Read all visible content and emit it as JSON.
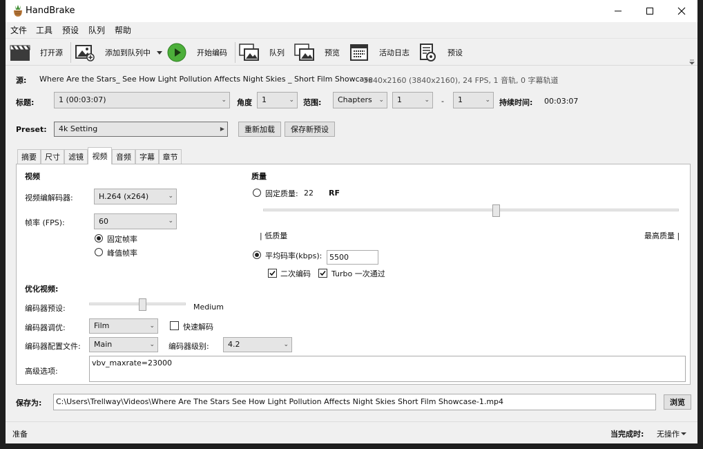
{
  "window": {
    "title": "HandBrake"
  },
  "menu": [
    "文件",
    "工具",
    "预设",
    "队列",
    "帮助"
  ],
  "toolbar": {
    "open_source": "打开源",
    "add_to_queue": "添加到队列中",
    "start_encode": "开始编码",
    "queue": "队列",
    "preview": "预览",
    "activity_log": "活动日志",
    "presets": "预设"
  },
  "source": {
    "label": "源:",
    "name": "Where Are the Stars_ See How Light Pollution Affects Night Skies _ Short Film Showcase",
    "info": "3840x2160 (3840x2160), 24 FPS, 1 音轨, 0 字幕轨道"
  },
  "title_row": {
    "title_label": "标题:",
    "title_value": "1 (00:03:07)",
    "angle_label": "角度",
    "angle_value": "1",
    "range_label": "范围:",
    "range_mode": "Chapters",
    "range_start": "1",
    "dash": "-",
    "range_end": "1",
    "duration_label": "持续时间:",
    "duration_value": "00:03:07"
  },
  "preset": {
    "label": "Preset:",
    "value": "4k Setting",
    "reload": "重新加载",
    "save_new": "保存新预设"
  },
  "tabs": [
    "摘要",
    "尺寸",
    "滤镜",
    "视频",
    "音频",
    "字幕",
    "章节"
  ],
  "video": {
    "section": "视频",
    "codec_label": "视频编解码器:",
    "codec_value": "H.264 (x264)",
    "fps_label": "帧率 (FPS):",
    "fps_value": "60",
    "constant_fps": "固定帧率",
    "peak_fps": "峰值帧率"
  },
  "quality": {
    "section": "质量",
    "cq_label": "固定质量:",
    "cq_value": "22",
    "cq_unit": "RF",
    "cq_slider_fraction": 0.56,
    "low_label": "| 低质量",
    "high_label": "最高质量 |",
    "abr_label": "平均码率(kbps):",
    "abr_value": "5500",
    "two_pass": "二次编码",
    "turbo": "Turbo 一次通过"
  },
  "optimise": {
    "section": "优化视频:",
    "preset_label": "编码器预设:",
    "preset_value": "Medium",
    "preset_slider_fraction": 0.55,
    "tune_label": "编码器调优:",
    "tune_value": "Film",
    "fast_decode": "快速解码",
    "profile_label": "编码器配置文件:",
    "profile_value": "Main",
    "level_label": "编码器级别:",
    "level_value": "4.2",
    "advanced_label": "高级选项:",
    "advanced_value": "vbv_maxrate=23000"
  },
  "save": {
    "label": "保存为:",
    "path": "C:\\Users\\Trellway\\Videos\\Where Are The Stars  See How Light Pollution Affects Night Skies   Short Film Showcase-1.mp4",
    "browse": "浏览"
  },
  "status": {
    "left": "准备",
    "when_done_label": "当完成时:",
    "when_done_value": "无操作"
  }
}
